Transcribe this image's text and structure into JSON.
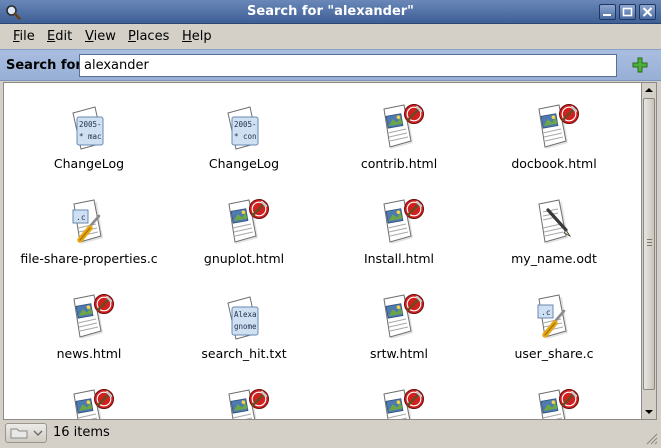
{
  "window": {
    "title": "Search for \"alexander\""
  },
  "menu": [
    {
      "label": "File",
      "mnemonic": "F",
      "rest": "ile"
    },
    {
      "label": "Edit",
      "mnemonic": "E",
      "rest": "dit"
    },
    {
      "label": "View",
      "mnemonic": "V",
      "rest": "iew"
    },
    {
      "label": "Places",
      "mnemonic": "P",
      "rest": "laces"
    },
    {
      "label": "Help",
      "mnemonic": "H",
      "rest": "elp"
    }
  ],
  "search": {
    "label": "Search for:",
    "value": "alexander"
  },
  "files": [
    {
      "name": "ChangeLog",
      "icon": "text-file-icon",
      "preview": [
        "2005-",
        "* mac"
      ]
    },
    {
      "name": "ChangeLog",
      "icon": "text-file-icon",
      "preview": [
        "2005-",
        "* con"
      ]
    },
    {
      "name": "contrib.html",
      "icon": "html-file-icon"
    },
    {
      "name": "docbook.html",
      "icon": "html-file-icon"
    },
    {
      "name": "file-share-properties.c",
      "icon": "c-source-file-icon"
    },
    {
      "name": "gnuplot.html",
      "icon": "html-file-icon"
    },
    {
      "name": "Install.html",
      "icon": "html-file-icon"
    },
    {
      "name": "my_name.odt",
      "icon": "document-file-icon"
    },
    {
      "name": "news.html",
      "icon": "html-file-icon"
    },
    {
      "name": "search_hit.txt",
      "icon": "text-file-icon",
      "preview": [
        "Alexa",
        "gnome"
      ]
    },
    {
      "name": "srtw.html",
      "icon": "html-file-icon"
    },
    {
      "name": "user_share.c",
      "icon": "c-source-file-icon"
    },
    {
      "name": "",
      "icon": "html-file-icon"
    },
    {
      "name": "",
      "icon": "html-file-icon"
    },
    {
      "name": "",
      "icon": "html-file-icon"
    },
    {
      "name": "",
      "icon": "html-file-icon"
    }
  ],
  "status": {
    "text": "16 items"
  }
}
